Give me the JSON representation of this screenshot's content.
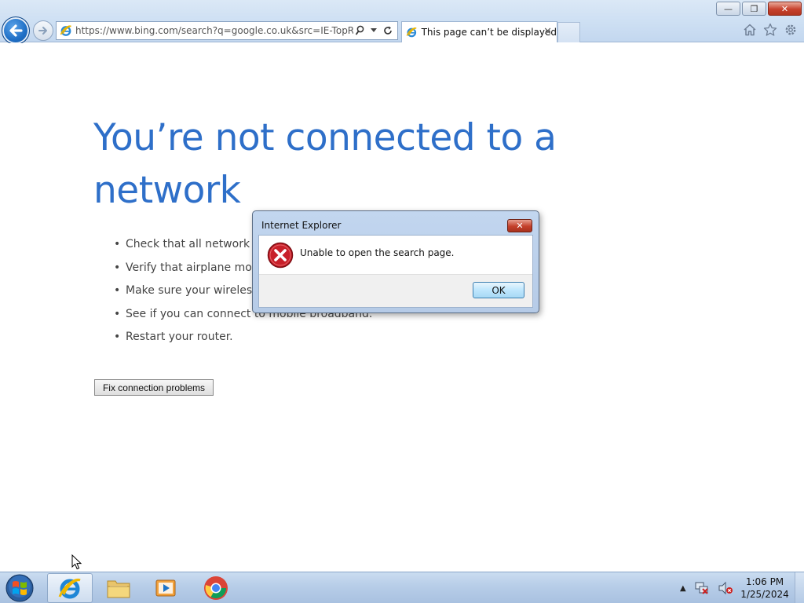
{
  "browser": {
    "address_url": "https://www.bing.com/search?q=google.co.uk&src=IE-TopResult&",
    "tab_title": "This page can’t be displayed",
    "tab_close": "✕",
    "window_buttons": {
      "minimize": "—",
      "restore": "❐",
      "close": "✕"
    }
  },
  "page": {
    "heading": "You’re not connected to a network",
    "tips": [
      "Check that all network cables are plugged in.",
      "Verify that airplane mode is turned off.",
      "Make sure your wireless switch is turned on.",
      "See if you can connect to mobile broadband.",
      "Restart your router."
    ],
    "bullet": "•",
    "fix_button": "Fix connection problems"
  },
  "dialog": {
    "title": "Internet Explorer",
    "close": "✕",
    "message": "Unable to open the search page.",
    "ok_button": "OK"
  },
  "taskbar": {
    "time": "1:06 PM",
    "date": "1/25/2024",
    "tray_arrow": "▲"
  },
  "colors": {
    "heading_blue": "#2e6fc9",
    "close_red": "#c4402b",
    "error_red": "#c8202a"
  },
  "icons": [
    "back-arrow-icon",
    "forward-arrow-icon",
    "ie-logo-icon",
    "search-icon",
    "dropdown-icon",
    "refresh-icon",
    "home-icon",
    "star-icon",
    "gear-icon",
    "error-icon",
    "windows-logo-icon",
    "file-explorer-icon",
    "media-player-icon",
    "chrome-icon",
    "network-icon",
    "volume-muted-icon",
    "mouse-cursor-icon"
  ]
}
